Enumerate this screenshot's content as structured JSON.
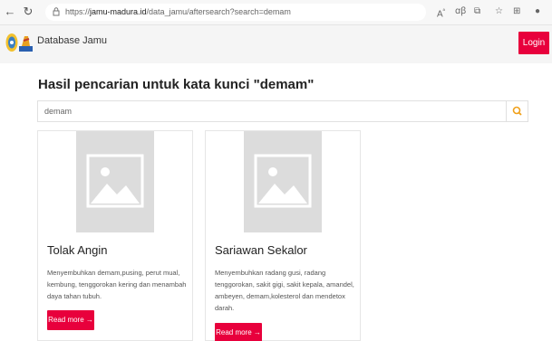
{
  "browser": {
    "url_prefix": "https://",
    "url_domain": "jamu-madura.id",
    "url_path": "/data_jamu/aftersearch?search=demam"
  },
  "navbar": {
    "brand": "Database Jamu",
    "login_label": "Login"
  },
  "main": {
    "title": "Hasil pencarian untuk kata kunci \"demam\"",
    "search_value": "demam",
    "cards": [
      {
        "title": "Tolak Angin",
        "description": "Menyembuhkan demam,pusing, perut mual, kembung, tenggorokan kering dan menambah daya tahan tubuh.",
        "button_label": "Read more →"
      },
      {
        "title": "Sariawan Sekalor",
        "description": "Menyembuhkan radang gusi, radang tenggorokan, sakit gigi, sakit kepala, amandel, ambeyen, demam,kolesterol dan mendetox darah.",
        "button_label": "Read more →"
      }
    ]
  },
  "colors": {
    "accent": "#e8003c",
    "search_icon": "#f0a01a",
    "placeholder_image": "#dcdcdc"
  },
  "icons": {
    "back": "back-arrow-icon",
    "refresh": "refresh-icon",
    "lock": "lock-icon",
    "search": "search-icon",
    "image": "image-placeholder-icon"
  }
}
